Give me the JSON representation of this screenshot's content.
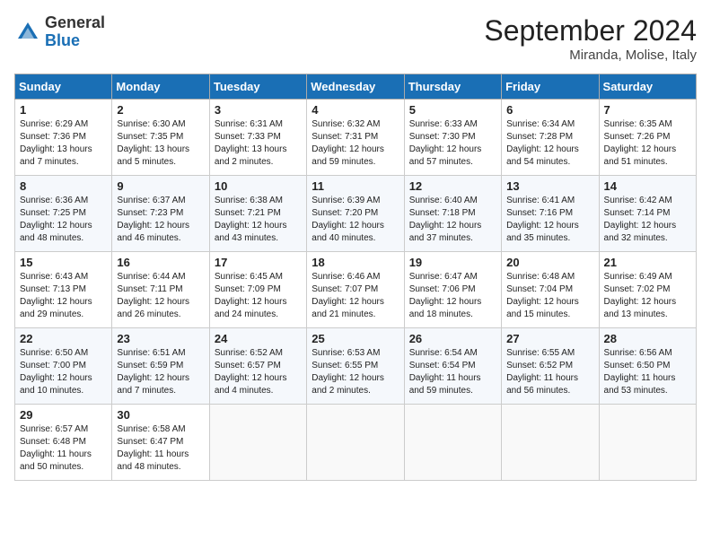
{
  "header": {
    "logo_general": "General",
    "logo_blue": "Blue",
    "month_title": "September 2024",
    "subtitle": "Miranda, Molise, Italy"
  },
  "columns": [
    "Sunday",
    "Monday",
    "Tuesday",
    "Wednesday",
    "Thursday",
    "Friday",
    "Saturday"
  ],
  "weeks": [
    [
      {
        "day": "1",
        "sunrise": "Sunrise: 6:29 AM",
        "sunset": "Sunset: 7:36 PM",
        "daylight": "Daylight: 13 hours and 7 minutes."
      },
      {
        "day": "2",
        "sunrise": "Sunrise: 6:30 AM",
        "sunset": "Sunset: 7:35 PM",
        "daylight": "Daylight: 13 hours and 5 minutes."
      },
      {
        "day": "3",
        "sunrise": "Sunrise: 6:31 AM",
        "sunset": "Sunset: 7:33 PM",
        "daylight": "Daylight: 13 hours and 2 minutes."
      },
      {
        "day": "4",
        "sunrise": "Sunrise: 6:32 AM",
        "sunset": "Sunset: 7:31 PM",
        "daylight": "Daylight: 12 hours and 59 minutes."
      },
      {
        "day": "5",
        "sunrise": "Sunrise: 6:33 AM",
        "sunset": "Sunset: 7:30 PM",
        "daylight": "Daylight: 12 hours and 57 minutes."
      },
      {
        "day": "6",
        "sunrise": "Sunrise: 6:34 AM",
        "sunset": "Sunset: 7:28 PM",
        "daylight": "Daylight: 12 hours and 54 minutes."
      },
      {
        "day": "7",
        "sunrise": "Sunrise: 6:35 AM",
        "sunset": "Sunset: 7:26 PM",
        "daylight": "Daylight: 12 hours and 51 minutes."
      }
    ],
    [
      {
        "day": "8",
        "sunrise": "Sunrise: 6:36 AM",
        "sunset": "Sunset: 7:25 PM",
        "daylight": "Daylight: 12 hours and 48 minutes."
      },
      {
        "day": "9",
        "sunrise": "Sunrise: 6:37 AM",
        "sunset": "Sunset: 7:23 PM",
        "daylight": "Daylight: 12 hours and 46 minutes."
      },
      {
        "day": "10",
        "sunrise": "Sunrise: 6:38 AM",
        "sunset": "Sunset: 7:21 PM",
        "daylight": "Daylight: 12 hours and 43 minutes."
      },
      {
        "day": "11",
        "sunrise": "Sunrise: 6:39 AM",
        "sunset": "Sunset: 7:20 PM",
        "daylight": "Daylight: 12 hours and 40 minutes."
      },
      {
        "day": "12",
        "sunrise": "Sunrise: 6:40 AM",
        "sunset": "Sunset: 7:18 PM",
        "daylight": "Daylight: 12 hours and 37 minutes."
      },
      {
        "day": "13",
        "sunrise": "Sunrise: 6:41 AM",
        "sunset": "Sunset: 7:16 PM",
        "daylight": "Daylight: 12 hours and 35 minutes."
      },
      {
        "day": "14",
        "sunrise": "Sunrise: 6:42 AM",
        "sunset": "Sunset: 7:14 PM",
        "daylight": "Daylight: 12 hours and 32 minutes."
      }
    ],
    [
      {
        "day": "15",
        "sunrise": "Sunrise: 6:43 AM",
        "sunset": "Sunset: 7:13 PM",
        "daylight": "Daylight: 12 hours and 29 minutes."
      },
      {
        "day": "16",
        "sunrise": "Sunrise: 6:44 AM",
        "sunset": "Sunset: 7:11 PM",
        "daylight": "Daylight: 12 hours and 26 minutes."
      },
      {
        "day": "17",
        "sunrise": "Sunrise: 6:45 AM",
        "sunset": "Sunset: 7:09 PM",
        "daylight": "Daylight: 12 hours and 24 minutes."
      },
      {
        "day": "18",
        "sunrise": "Sunrise: 6:46 AM",
        "sunset": "Sunset: 7:07 PM",
        "daylight": "Daylight: 12 hours and 21 minutes."
      },
      {
        "day": "19",
        "sunrise": "Sunrise: 6:47 AM",
        "sunset": "Sunset: 7:06 PM",
        "daylight": "Daylight: 12 hours and 18 minutes."
      },
      {
        "day": "20",
        "sunrise": "Sunrise: 6:48 AM",
        "sunset": "Sunset: 7:04 PM",
        "daylight": "Daylight: 12 hours and 15 minutes."
      },
      {
        "day": "21",
        "sunrise": "Sunrise: 6:49 AM",
        "sunset": "Sunset: 7:02 PM",
        "daylight": "Daylight: 12 hours and 13 minutes."
      }
    ],
    [
      {
        "day": "22",
        "sunrise": "Sunrise: 6:50 AM",
        "sunset": "Sunset: 7:00 PM",
        "daylight": "Daylight: 12 hours and 10 minutes."
      },
      {
        "day": "23",
        "sunrise": "Sunrise: 6:51 AM",
        "sunset": "Sunset: 6:59 PM",
        "daylight": "Daylight: 12 hours and 7 minutes."
      },
      {
        "day": "24",
        "sunrise": "Sunrise: 6:52 AM",
        "sunset": "Sunset: 6:57 PM",
        "daylight": "Daylight: 12 hours and 4 minutes."
      },
      {
        "day": "25",
        "sunrise": "Sunrise: 6:53 AM",
        "sunset": "Sunset: 6:55 PM",
        "daylight": "Daylight: 12 hours and 2 minutes."
      },
      {
        "day": "26",
        "sunrise": "Sunrise: 6:54 AM",
        "sunset": "Sunset: 6:54 PM",
        "daylight": "Daylight: 11 hours and 59 minutes."
      },
      {
        "day": "27",
        "sunrise": "Sunrise: 6:55 AM",
        "sunset": "Sunset: 6:52 PM",
        "daylight": "Daylight: 11 hours and 56 minutes."
      },
      {
        "day": "28",
        "sunrise": "Sunrise: 6:56 AM",
        "sunset": "Sunset: 6:50 PM",
        "daylight": "Daylight: 11 hours and 53 minutes."
      }
    ],
    [
      {
        "day": "29",
        "sunrise": "Sunrise: 6:57 AM",
        "sunset": "Sunset: 6:48 PM",
        "daylight": "Daylight: 11 hours and 50 minutes."
      },
      {
        "day": "30",
        "sunrise": "Sunrise: 6:58 AM",
        "sunset": "Sunset: 6:47 PM",
        "daylight": "Daylight: 11 hours and 48 minutes."
      },
      null,
      null,
      null,
      null,
      null
    ]
  ]
}
